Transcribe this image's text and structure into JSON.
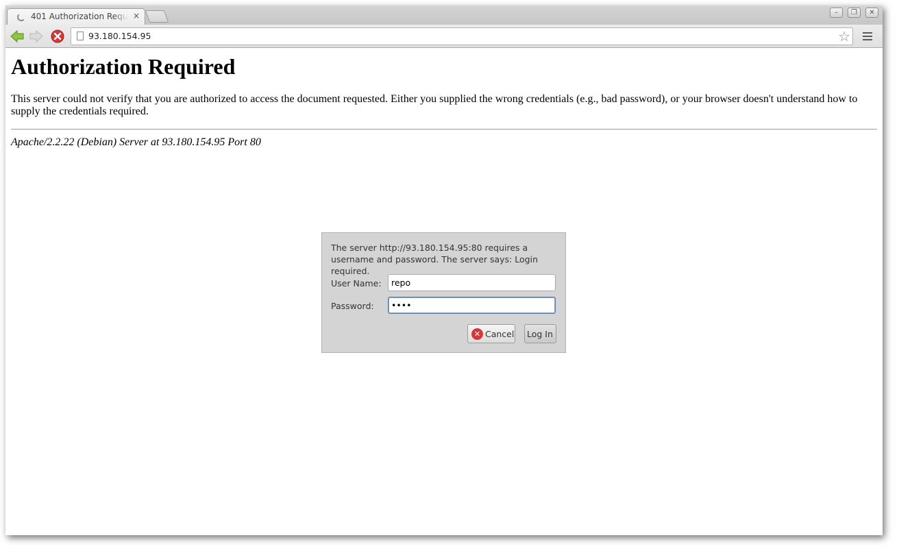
{
  "browser": {
    "tab_title": "401 Authorization Required",
    "tab_close": "×",
    "address": "93.180.154.95",
    "window_buttons": {
      "minimize": "–",
      "restore": "❐",
      "close": "✕"
    }
  },
  "page": {
    "heading": "Authorization Required",
    "message": "This server could not verify that you are authorized to access the document requested. Either you supplied the wrong credentials (e.g., bad password), or your browser doesn't understand how to supply the credentials required.",
    "footer": "Apache/2.2.22 (Debian) Server at 93.180.154.95 Port 80"
  },
  "dialog": {
    "message": "The server http://93.180.154.95:80 requires a username and password. The server says: Login required.",
    "username_label": "User Name:",
    "username_value": "repo",
    "password_label": "Password:",
    "password_value": "••••",
    "cancel_label": "Cancel",
    "login_label": "Log In"
  },
  "icons": {
    "back": "back-arrow-icon",
    "forward": "forward-arrow-icon",
    "stop": "stop-icon",
    "page": "page-icon",
    "star": "star-icon",
    "menu": "menu-icon"
  },
  "colors": {
    "back_arrow": "#8dc63f",
    "stop_red": "#d23a3a",
    "dialog_bg": "#d4d4d4"
  }
}
